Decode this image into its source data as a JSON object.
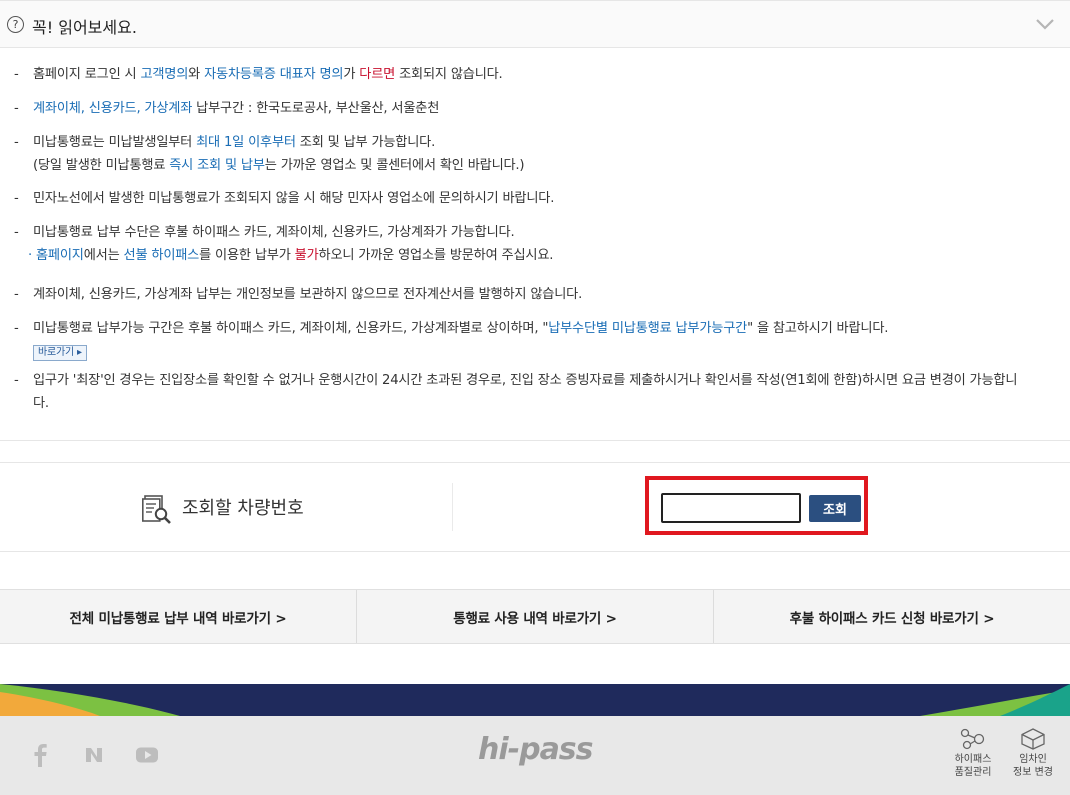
{
  "notice": {
    "qmark": "?",
    "title": "꼭! 읽어보세요."
  },
  "items": {
    "i1": {
      "a": "홈페이지 로그인 시 ",
      "b": "고객명의",
      "c": "와 ",
      "d": "자동차등록증 대표자 명의",
      "e": "가 ",
      "f": "다르면",
      "g": " 조회되지 않습니다."
    },
    "i2": {
      "a": "계좌이체, 신용카드, 가상계좌",
      "b": " 납부구간 : 한국도로공사, 부산울산, 서울춘천"
    },
    "i3": {
      "a": "미납통행료는 미납발생일부터 ",
      "b": "최대 1일 이후부터",
      "c": " 조회 및 납부 가능합니다.",
      "d": "(당일 발생한 미납통행료 ",
      "e": "즉시 조회 및 납부",
      "f": "는 가까운 영업소 및 콜센터에서 확인 바랍니다.)"
    },
    "i4": {
      "a": "민자노선에서 발생한 미납통행료가 조회되지 않을 시 해당 민자사 영업소에 문의하시기 바랍니다."
    },
    "i5": {
      "a": "미납통행료 납부 수단은 후불 하이패스 카드, 계좌이체, 신용카드, 가상계좌가 가능합니다.",
      "s1": "홈페이지",
      "s2": "에서는 ",
      "s3": "선불 하이패스",
      "s4": "를 이용한 납부가 ",
      "s5": "불가",
      "s6": "하오니 가까운 영업소를 방문하여 주십시요."
    },
    "i6": {
      "a": "계좌이체, 신용카드, 가상계좌 납부는 개인정보를 보관하지 않으므로 전자계산서를 발행하지 않습니다."
    },
    "i7": {
      "a": "미납통행료 납부가능 구간은 후불 하이패스 카드, 계좌이체, 신용카드, 가상계좌별로 상이하며, \"",
      "b": "납부수단별 미납통행료 납부가능구간",
      "c": "\" 을 참고하시기 바랍니다.",
      "btn": "바로가기 ▸"
    },
    "i8": {
      "a": "입구가 '최장'인 경우는 진입장소를 확인할 수 없거나 운행시간이 24시간 초과된 경우로, 진입 장소 증빙자료를 제출하시거나 확인서를 작성(연1회에 한함)하시면 요금 변경이 가능합니다."
    },
    "dash": "-"
  },
  "search": {
    "label": "조회할 차량번호",
    "input_value": "",
    "input_placeholder": "",
    "button": "조회"
  },
  "links": [
    "전체 미납통행료 납부 내역 바로가기 >",
    "통행료 사용 내역 바로가기 >",
    "후불 하이패스 카드 신청 바로가기 >"
  ],
  "footer": {
    "logo": "hi-pass",
    "sns_icons": [
      "facebook-icon",
      "naver-icon",
      "youtube-icon"
    ],
    "tools": [
      {
        "line1": "하이패스",
        "line2": "품질관리"
      },
      {
        "line1": "임차인",
        "line2": "정보 변경"
      }
    ]
  },
  "colors": {
    "link_blue": "#1a6db5",
    "warn_red": "#c8102e",
    "button_navy": "#2b4f80",
    "highlight_red": "#e0181f",
    "band_navy": "#1f2a5c"
  }
}
